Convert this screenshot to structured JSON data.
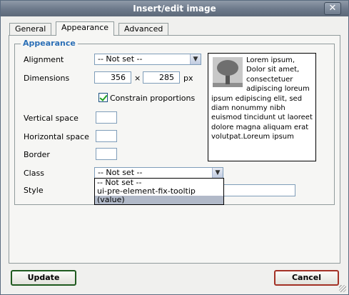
{
  "window": {
    "title": "Insert/edit image",
    "close_label": "✕"
  },
  "tabs": [
    {
      "label": "General",
      "active": false
    },
    {
      "label": "Appearance",
      "active": true
    },
    {
      "label": "Advanced",
      "active": false
    }
  ],
  "appearance": {
    "legend": "Appearance",
    "alignment": {
      "label": "Alignment",
      "value": "-- Not set --"
    },
    "dimensions": {
      "label": "Dimensions",
      "width": "356",
      "height": "285",
      "separator": "×",
      "unit": "px"
    },
    "constrain": {
      "label": "Constrain proportions",
      "checked": true
    },
    "vertical_space": {
      "label": "Vertical space",
      "value": ""
    },
    "horizontal_space": {
      "label": "Horizontal space",
      "value": ""
    },
    "border": {
      "label": "Border",
      "value": ""
    },
    "class": {
      "label": "Class",
      "value": "-- Not set --",
      "options": [
        "-- Not set --",
        "ui-pre-element-fix-tooltip",
        "(value)"
      ],
      "highlighted_option": "(value)"
    },
    "style": {
      "label": "Style",
      "value": ""
    },
    "preview_text": "Lorem ipsum, Dolor sit amet, consectetuer adipiscing loreum ipsum edipiscing elit, sed diam nonummy nibh euismod tincidunt ut laoreet dolore magna aliquam erat volutpat.Loreum ipsum"
  },
  "buttons": {
    "update": "Update",
    "cancel": "Cancel"
  },
  "icons": {
    "close": "close-icon",
    "dropdown": "chevron-down-icon",
    "preview_image": "tree-image",
    "resize": "resize-grip-icon"
  }
}
